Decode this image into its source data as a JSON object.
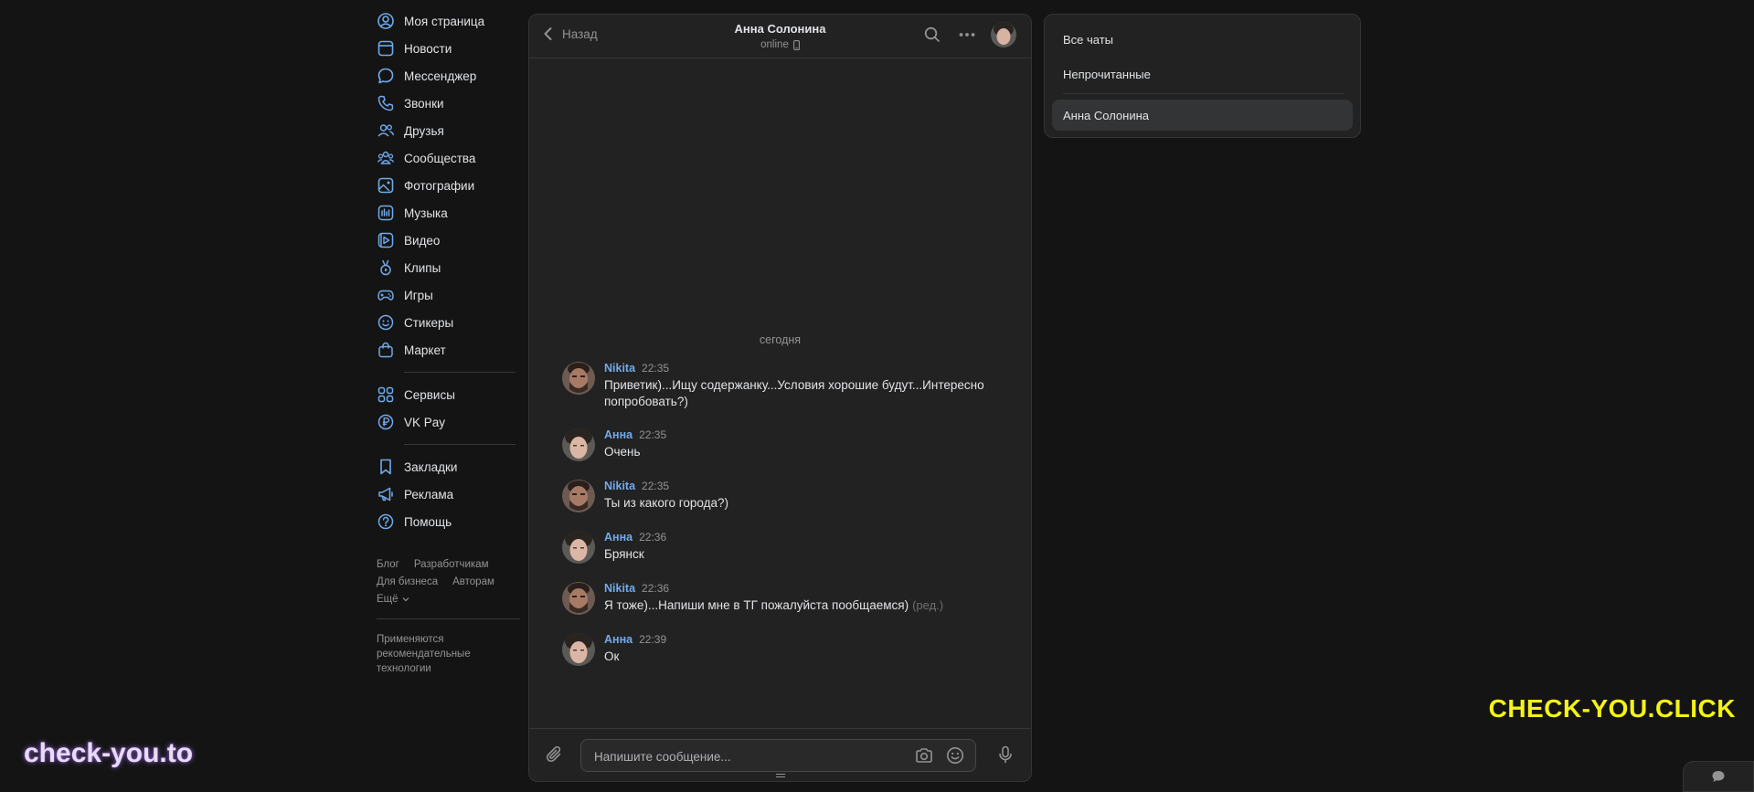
{
  "nav": {
    "main": [
      {
        "key": "profile",
        "label": "Моя страница",
        "icon": "user-circle-icon"
      },
      {
        "key": "news",
        "label": "Новости",
        "icon": "newspaper-icon"
      },
      {
        "key": "messenger",
        "label": "Мессенджер",
        "icon": "message-bubble-icon"
      },
      {
        "key": "calls",
        "label": "Звонки",
        "icon": "phone-icon"
      },
      {
        "key": "friends",
        "label": "Друзья",
        "icon": "users-icon"
      },
      {
        "key": "communities",
        "label": "Сообщества",
        "icon": "community-icon"
      },
      {
        "key": "photos",
        "label": "Фотографии",
        "icon": "picture-icon"
      },
      {
        "key": "music",
        "label": "Музыка",
        "icon": "music-icon"
      },
      {
        "key": "video",
        "label": "Видео",
        "icon": "video-icon"
      },
      {
        "key": "clips",
        "label": "Клипы",
        "icon": "clips-icon"
      },
      {
        "key": "games",
        "label": "Игры",
        "icon": "gamepad-icon"
      },
      {
        "key": "stickers",
        "label": "Стикеры",
        "icon": "smile-icon"
      },
      {
        "key": "market",
        "label": "Маркет",
        "icon": "shopping-bag-icon"
      }
    ],
    "services": [
      {
        "key": "services",
        "label": "Сервисы",
        "icon": "grid-icon"
      },
      {
        "key": "vkpay",
        "label": "VK Pay",
        "icon": "ruble-circle-icon"
      }
    ],
    "extra": [
      {
        "key": "bookmarks",
        "label": "Закладки",
        "icon": "bookmark-icon"
      },
      {
        "key": "ads",
        "label": "Реклама",
        "icon": "megaphone-icon"
      },
      {
        "key": "help",
        "label": "Помощь",
        "icon": "question-circle-icon"
      }
    ],
    "footer_links": {
      "blog": "Блог",
      "developers": "Разработчикам",
      "business": "Для бизнеса",
      "authors": "Авторам",
      "more": "Ещё"
    },
    "footer_note": "Применяются рекомендательные технологии"
  },
  "chat": {
    "back_label": "Назад",
    "peer_name": "Анна Солонина",
    "peer_status": "online",
    "date_separator": "сегодня",
    "messages": [
      {
        "author": "Nikita",
        "time": "22:35",
        "text": "Приветик)...Ищу содержанку...Условия хорошие будут...Интересно попробовать?)",
        "edited": "",
        "avatar": "nikita"
      },
      {
        "author": "Анна",
        "time": "22:35",
        "text": "Очень",
        "edited": "",
        "avatar": "anna"
      },
      {
        "author": "Nikita",
        "time": "22:35",
        "text": "Ты из какого города?)",
        "edited": "",
        "avatar": "nikita"
      },
      {
        "author": "Анна",
        "time": "22:36",
        "text": "Брянск",
        "edited": "",
        "avatar": "anna"
      },
      {
        "author": "Nikita",
        "time": "22:36",
        "text": "Я тоже)...Напиши мне в ТГ пожалуйста пообщаемся)",
        "edited": "(ред.)",
        "avatar": "nikita"
      },
      {
        "author": "Анна",
        "time": "22:39",
        "text": "Ок",
        "edited": "",
        "avatar": "anna"
      }
    ],
    "composer": {
      "placeholder": "Напишите сообщение...",
      "value": ""
    }
  },
  "filters": {
    "all": "Все чаты",
    "unread": "Непрочитанные",
    "current": "Анна Солонина"
  },
  "watermarks": {
    "right": "CHECK-YOU.CLICK",
    "left": "check-you.to"
  },
  "colors": {
    "accent": "#71aaeb",
    "background": "#141414",
    "panel": "#222222",
    "watermark_right": "#f4f318"
  }
}
